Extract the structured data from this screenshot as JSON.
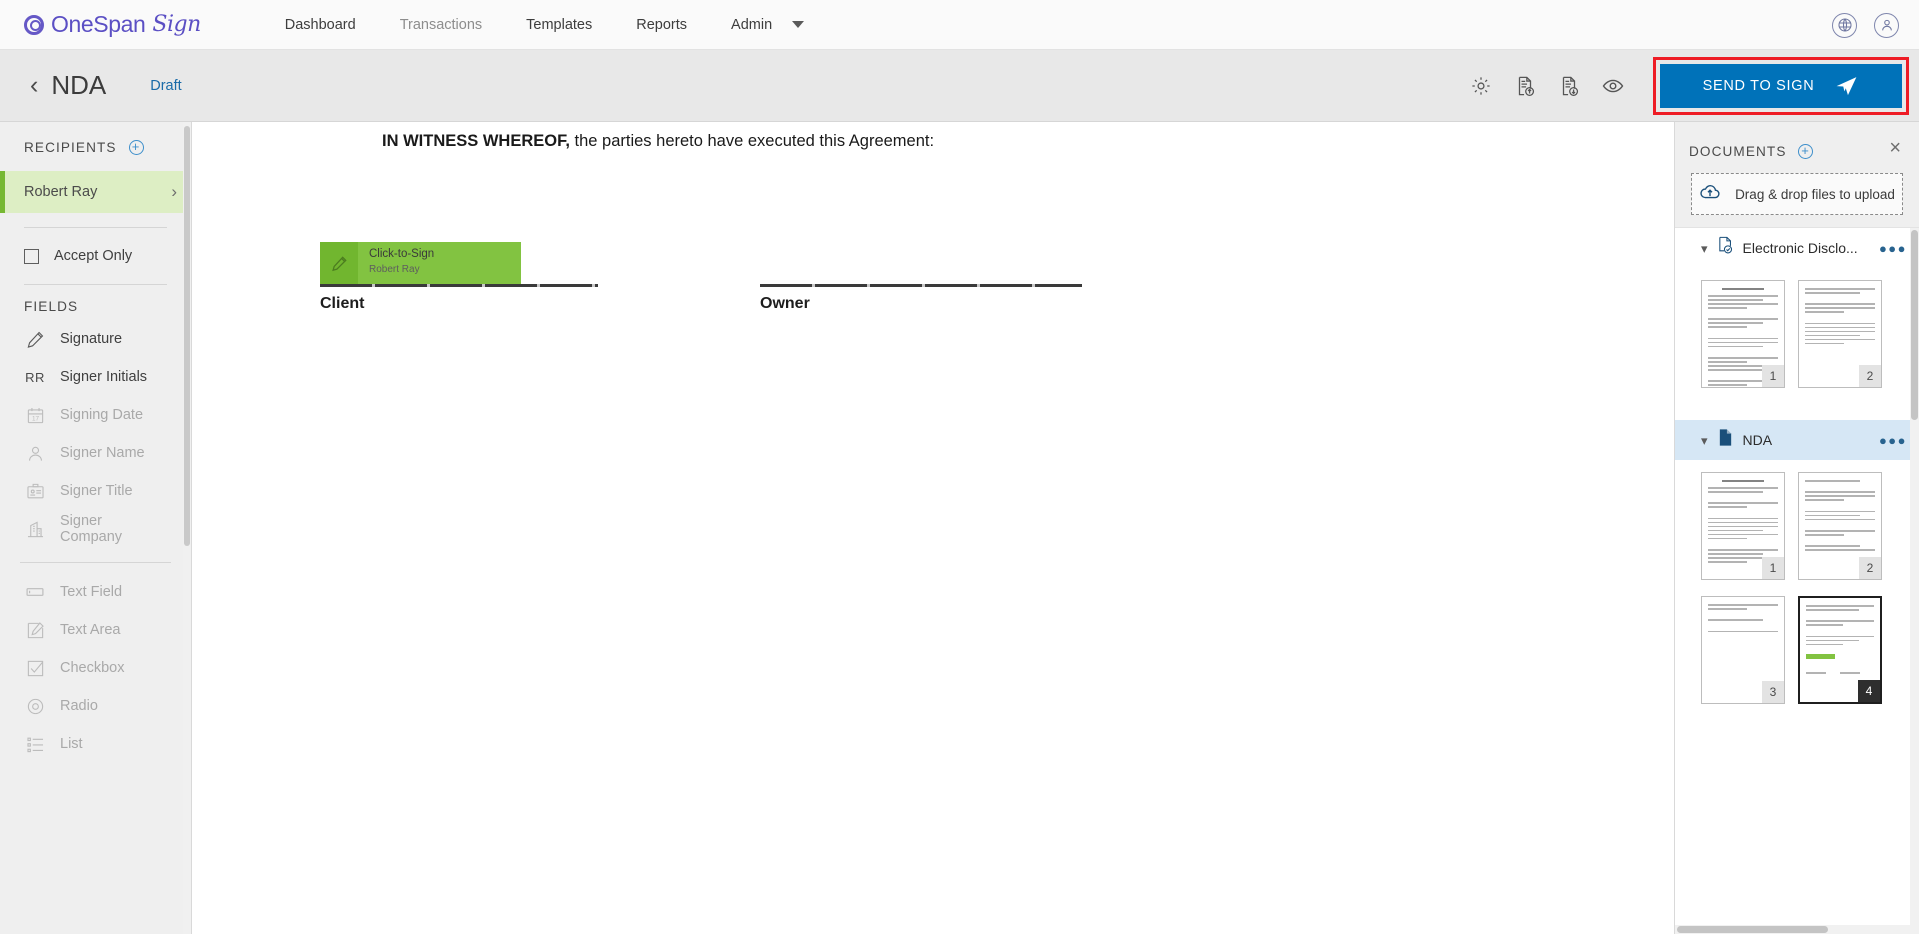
{
  "topnav": {
    "brand_primary": "OneSpan",
    "brand_script": "Sign",
    "items": [
      {
        "label": "Dashboard",
        "muted": false
      },
      {
        "label": "Transactions",
        "muted": true
      },
      {
        "label": "Templates",
        "muted": false
      },
      {
        "label": "Reports",
        "muted": false
      },
      {
        "label": "Admin",
        "muted": false
      }
    ],
    "right_icons": [
      {
        "name": "globe-icon"
      },
      {
        "name": "user-account-icon"
      }
    ]
  },
  "docbar": {
    "back_label": "‹",
    "title": "NDA",
    "status": "Draft",
    "tools": [
      {
        "name": "settings-gear-icon"
      },
      {
        "name": "document-upload-icon"
      },
      {
        "name": "document-download-icon"
      },
      {
        "name": "preview-eye-icon"
      }
    ],
    "send_label": "SEND TO SIGN",
    "send_color": "#0072b9",
    "highlight_color": "#ee1c25"
  },
  "sidebar": {
    "recipients_header": "RECIPIENTS",
    "recipients": [
      {
        "name": "Robert Ray",
        "selected": true
      }
    ],
    "accept_only_label": "Accept Only",
    "accept_only_checked": false,
    "fields_header": "FIELDS",
    "fields": [
      {
        "label": "Signature",
        "icon": "pencil-icon",
        "disabled": false
      },
      {
        "label": "Signer Initials",
        "icon": "initials-rr-icon",
        "disabled": false
      },
      {
        "label": "Signing Date",
        "icon": "calendar-icon",
        "disabled": true
      },
      {
        "label": "Signer Name",
        "icon": "person-icon",
        "disabled": true
      },
      {
        "label": "Signer Title",
        "icon": "id-badge-icon",
        "disabled": true
      },
      {
        "label": "Signer Company",
        "icon": "building-icon",
        "disabled": true
      }
    ],
    "fields_secondary": [
      {
        "label": "Text Field",
        "icon": "text-field-icon",
        "disabled": true
      },
      {
        "label": "Text Area",
        "icon": "text-area-icon",
        "disabled": true
      },
      {
        "label": "Checkbox",
        "icon": "checkbox-icon",
        "disabled": true
      },
      {
        "label": "Radio",
        "icon": "radio-icon",
        "disabled": true
      },
      {
        "label": "List",
        "icon": "list-icon",
        "disabled": true
      }
    ]
  },
  "canvas": {
    "witness_bold": "IN WITNESS WHEREOF,",
    "witness_rest": " the parties hereto have executed this Agreement:",
    "signature_field": {
      "title": "Click-to-Sign",
      "signer": "Robert Ray",
      "color": "#82c341"
    },
    "client_label": "Client",
    "owner_label": "Owner"
  },
  "documents_panel": {
    "title": "DOCUMENTS",
    "close_label": "×",
    "dropzone_label": "Drag & drop files to upload",
    "dropzone_icon": "cloud-upload-icon",
    "groups": [
      {
        "name": "Electronic Disclo...",
        "icon": "document-check-icon",
        "selected": false,
        "menu": "●●●",
        "pages": [
          {
            "number": "1",
            "active": false
          },
          {
            "number": "2",
            "active": false
          }
        ]
      },
      {
        "name": "NDA",
        "icon": "document-filled-icon",
        "selected": true,
        "menu": "●●●",
        "pages": [
          {
            "number": "1",
            "active": false
          },
          {
            "number": "2",
            "active": false
          },
          {
            "number": "3",
            "active": false
          },
          {
            "number": "4",
            "active": true
          }
        ]
      }
    ]
  }
}
